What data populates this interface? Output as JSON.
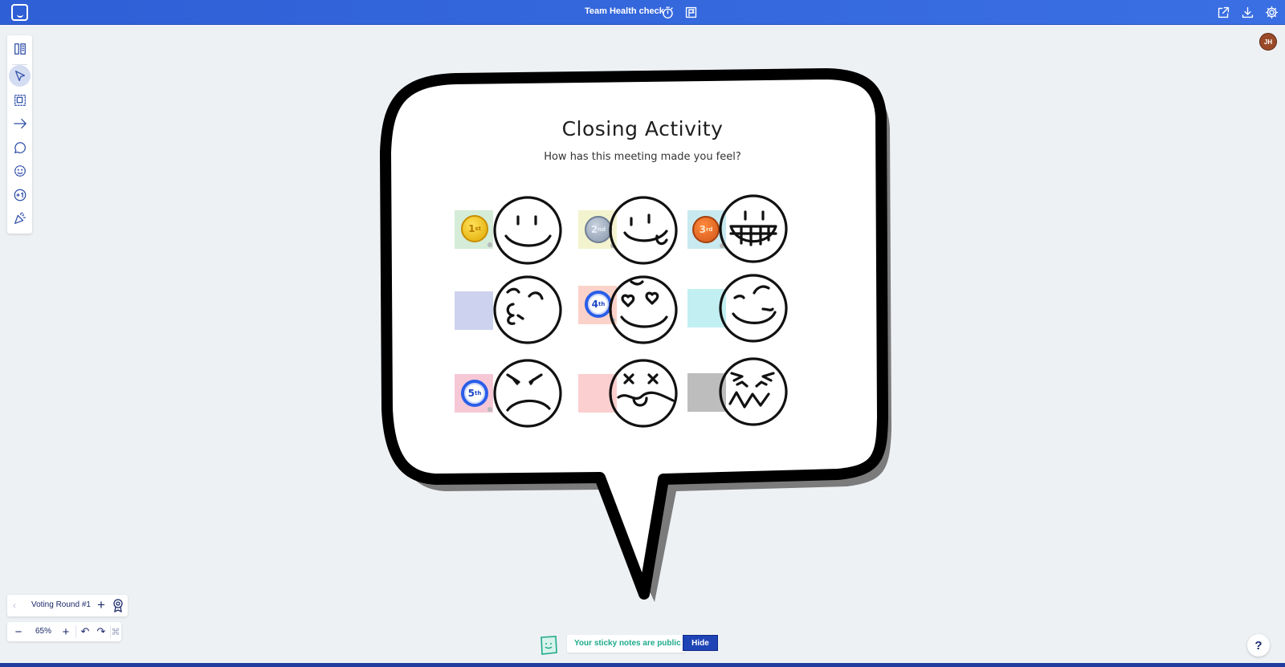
{
  "header": {
    "board_title": "Team Health check",
    "icons": [
      "app-logo",
      "timer-icon",
      "flag-icon",
      "share-icon",
      "download-icon",
      "settings-icon"
    ]
  },
  "toolbar": {
    "tools": [
      "board-panel-icon",
      "select-icon",
      "frame-icon",
      "arrow-icon",
      "comment-icon",
      "emoji-icon",
      "plus-one-icon",
      "party-icon"
    ],
    "active_tool": "select-icon"
  },
  "user": {
    "initials": "JH"
  },
  "canvas": {
    "title": "Closing Activity",
    "subtitle": "How has this meeting made you feel?",
    "faces": [
      {
        "face": "smile",
        "sticky_color": "#d4ecd8",
        "medal": {
          "rank": "1",
          "suffix": "st",
          "style": "gold"
        }
      },
      {
        "face": "tongue-out",
        "sticky_color": "#f3f3cf",
        "medal": {
          "rank": "2",
          "suffix": "nd",
          "style": "silver"
        }
      },
      {
        "face": "big-grin",
        "sticky_color": "#c7e9ef",
        "medal": {
          "rank": "3",
          "suffix": "rd",
          "style": "bronze"
        }
      },
      {
        "face": "kiss",
        "sticky_color": "#cdd3ee",
        "medal": null
      },
      {
        "face": "heart-eyes",
        "sticky_color": "#fbd2c9",
        "medal": {
          "rank": "4",
          "suffix": "th",
          "style": "blue"
        }
      },
      {
        "face": "wink",
        "sticky_color": "#c2eff2",
        "medal": null
      },
      {
        "face": "angry",
        "sticky_color": "#f6c8d6",
        "medal": {
          "rank": "5",
          "suffix": "th",
          "style": "blue"
        }
      },
      {
        "face": "dizzy-tongue",
        "sticky_color": "#fbcfcf",
        "medal": null
      },
      {
        "face": "frustrated",
        "sticky_color": "#bdbdbd",
        "medal": null
      }
    ]
  },
  "voting": {
    "round_label": "Voting Round #1",
    "zoom_label": "65%"
  },
  "notice": {
    "text": "Your sticky notes are public",
    "hide_label": "Hide"
  },
  "help": {
    "label": "?"
  },
  "colors": {
    "accent": "#2f5fd6",
    "navy": "#1b2a6b",
    "public_green": "#1eaa8a"
  }
}
